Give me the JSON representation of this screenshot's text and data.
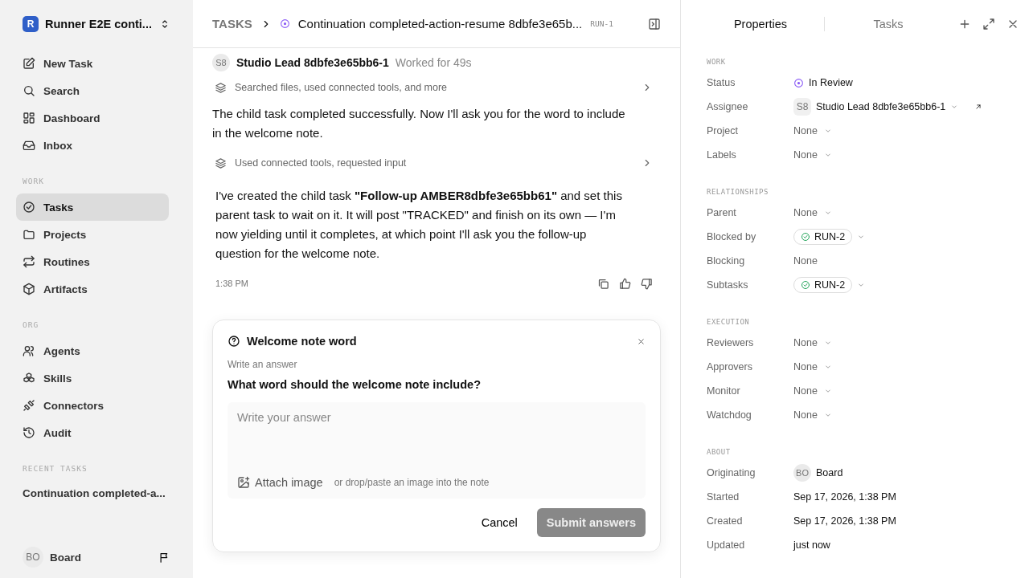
{
  "workspace": {
    "badge": "R",
    "name": "Runner E2E conti..."
  },
  "sidebar": {
    "top_items": [
      {
        "label": "New Task"
      },
      {
        "label": "Search"
      },
      {
        "label": "Dashboard"
      },
      {
        "label": "Inbox"
      }
    ],
    "work_title": "WORK",
    "work_items": [
      {
        "label": "Tasks",
        "selected": true
      },
      {
        "label": "Projects",
        "selected": false
      },
      {
        "label": "Routines",
        "selected": false
      },
      {
        "label": "Artifacts",
        "selected": false
      }
    ],
    "org_title": "ORG",
    "org_items": [
      {
        "label": "Agents",
        "selected": false
      },
      {
        "label": "Skills",
        "selected": false
      },
      {
        "label": "Connectors",
        "selected": false
      },
      {
        "label": "Audit",
        "selected": false
      }
    ],
    "recent_title": "RECENT TASKS",
    "recent_tasks": [
      "Continuation completed-a..."
    ],
    "user": {
      "initials": "BO",
      "name": "Board"
    }
  },
  "header": {
    "breadcrumb": "TASKS",
    "title": "Continuation completed-action-resume 8dbfe3e65b...",
    "id": "RUN-1"
  },
  "thread": {
    "author": {
      "initials": "S8",
      "name": "Studio Lead 8dbfe3e65bb6-1",
      "meta": "Worked for 49s"
    },
    "blocks": [
      {
        "kind": "activity",
        "text": "Searched files, used connected tools, and more"
      },
      {
        "kind": "text",
        "text": "The child task completed successfully. Now I'll ask you for the word to include in the welcome note."
      },
      {
        "kind": "activity",
        "text": "Used connected tools, requested input"
      },
      {
        "kind": "text",
        "text": "I've created the child task **\"Follow-up AMBER8dbfe3e65bb61\"** and set this parent task to wait on it. It will post \"TRACKED\" and finish on its own — I'm now yielding until it completes, at which point I'll ask you the follow-up question for the welcome note."
      }
    ],
    "time": "1:38 PM"
  },
  "question": {
    "title": "Welcome note word",
    "hint": "Write an answer",
    "question": "What word should the welcome note include?",
    "placeholder": "Write your answer",
    "attach": "Attach image",
    "attach_hint": "or drop/paste an image into the note",
    "cancel": "Cancel",
    "submit": "Submit answers",
    "submit_disabled": true
  },
  "panel": {
    "tabs": [
      {
        "label": "Properties",
        "selected": true
      },
      {
        "label": "Tasks",
        "selected": false
      }
    ],
    "sections": [
      {
        "title": "WORK",
        "rows": [
          {
            "label": "Status",
            "kind": "status",
            "value": "In Review"
          },
          {
            "label": "Assignee",
            "kind": "assignee",
            "initials": "S8",
            "value": "Studio Lead 8dbfe3e65bb6-1"
          },
          {
            "label": "Project",
            "kind": "dropdown",
            "value": "None"
          },
          {
            "label": "Labels",
            "kind": "dropdown",
            "value": "None"
          }
        ]
      },
      {
        "title": "RELATIONSHIPS",
        "rows": [
          {
            "label": "Parent",
            "kind": "dropdown",
            "value": "None"
          },
          {
            "label": "Blocked by",
            "kind": "chip",
            "value": "RUN-2"
          },
          {
            "label": "Blocking",
            "kind": "plain",
            "value": "None"
          },
          {
            "label": "Subtasks",
            "kind": "chip",
            "value": "RUN-2"
          }
        ]
      },
      {
        "title": "EXECUTION",
        "rows": [
          {
            "label": "Reviewers",
            "kind": "dropdown",
            "value": "None"
          },
          {
            "label": "Approvers",
            "kind": "dropdown",
            "value": "None"
          },
          {
            "label": "Monitor",
            "kind": "dropdown",
            "value": "None"
          },
          {
            "label": "Watchdog",
            "kind": "dropdown",
            "value": "None"
          }
        ]
      },
      {
        "title": "ABOUT",
        "rows": [
          {
            "label": "Originating",
            "kind": "person",
            "initials": "BO",
            "value": "Board"
          },
          {
            "label": "Started",
            "kind": "date",
            "value": "Sep 17, 2026, 1:38 PM"
          },
          {
            "label": "Created",
            "kind": "date",
            "value": "Sep 17, 2026, 1:38 PM"
          },
          {
            "label": "Updated",
            "kind": "date",
            "value": "just now"
          }
        ]
      }
    ]
  }
}
